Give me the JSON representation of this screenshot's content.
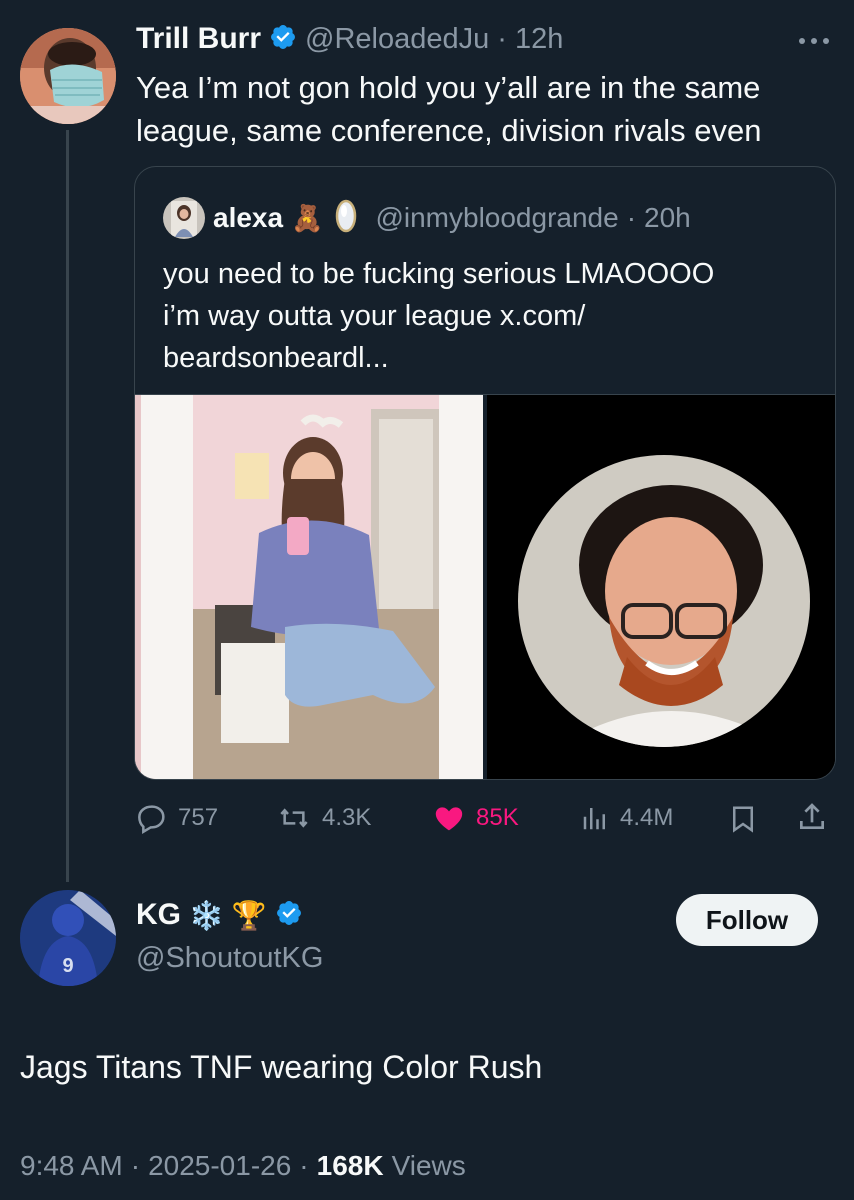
{
  "parent_tweet": {
    "author_name": "Trill Burr",
    "handle": "@ReloadedJu",
    "separator": "·",
    "time": "12h",
    "text": "Yea I’m not gon hold you y’all are in the same league, same conference, division rivals even",
    "more_icon": "more-dots-icon",
    "quote": {
      "author_name": "alexa",
      "emoji": "🧸",
      "handle": "@inmybloodgrande",
      "separator": "·",
      "time": "20h",
      "text_line1": "you need to be fucking serious LMAOOOO",
      "text_line2": "i’m way outta your league x.com/",
      "text_line3": "beardsonbeardl..."
    },
    "actions": {
      "replies": "757",
      "reposts": "4.3K",
      "likes": "85K",
      "views": "4.4M"
    },
    "colors": {
      "like": "#f91880",
      "verified": "#1d9bf0"
    }
  },
  "main_tweet": {
    "author_name": "KG",
    "emoji_1": "❄️",
    "emoji_2": "🏆",
    "handle": "@ShoutoutKG",
    "follow_label": "Follow",
    "text": "Jags Titans TNF wearing Color Rush",
    "time": "9:48 AM",
    "date": "2025-01-26",
    "views_count": "168K",
    "views_label": "Views",
    "separator": "·"
  }
}
